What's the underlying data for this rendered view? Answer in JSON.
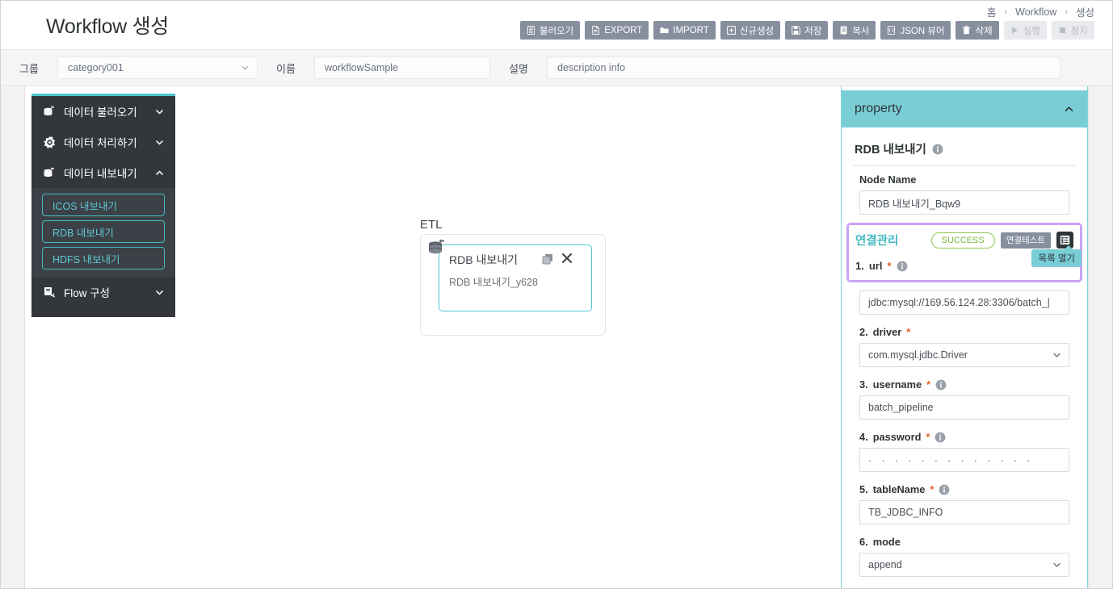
{
  "header": {
    "title": "Workflow 생성",
    "breadcrumb": [
      "홈",
      "Workflow",
      "생성"
    ],
    "breadcrumb_sep": "›",
    "toolbar": [
      {
        "label": "불러오기",
        "icon": "list-document-icon",
        "disabled": false
      },
      {
        "label": "EXPORT",
        "icon": "export-document-icon",
        "disabled": false
      },
      {
        "label": "IMPORT",
        "icon": "folder-icon",
        "disabled": false
      },
      {
        "label": "신규생성",
        "icon": "plus-square-icon",
        "disabled": false
      },
      {
        "label": "저장",
        "icon": "floppy-disk-icon",
        "disabled": false
      },
      {
        "label": "복사",
        "icon": "copy-document-icon",
        "disabled": false
      },
      {
        "label": "JSON 뷰어",
        "icon": "json-document-icon",
        "disabled": false
      },
      {
        "label": "삭제",
        "icon": "trash-icon",
        "disabled": false
      },
      {
        "label": "실행",
        "icon": "play-icon",
        "disabled": true
      },
      {
        "label": "정지",
        "icon": "stop-icon",
        "disabled": true
      }
    ]
  },
  "metabar": {
    "group": {
      "label": "그룹",
      "value": "category001",
      "icon": "chevron-down-icon"
    },
    "name": {
      "label": "이름",
      "value": "workflowSample"
    },
    "description": {
      "label": "설명",
      "value": "description info"
    }
  },
  "sidebar": {
    "groups": [
      {
        "label": "데이터 불러오기",
        "icon": "database-in-icon",
        "expanded": false,
        "chevron": "chevron-down-icon",
        "items": []
      },
      {
        "label": "데이터 처리하기",
        "icon": "gear-icon",
        "expanded": false,
        "chevron": "chevron-down-icon",
        "items": []
      },
      {
        "label": "데이터 내보내기",
        "icon": "database-out-icon",
        "expanded": true,
        "chevron": "chevron-up-icon",
        "items": [
          {
            "label": "ICOS 내보내기"
          },
          {
            "label": "RDB 내보내기"
          },
          {
            "label": "HDFS 내보내기"
          }
        ]
      },
      {
        "label": "Flow 구성",
        "icon": "flow-icon",
        "expanded": false,
        "chevron": "chevron-down-icon",
        "items": []
      }
    ]
  },
  "canvas": {
    "group_label": "ETL",
    "node": {
      "icon": "database-out-icon",
      "title": "RDB 내보내기",
      "subtitle": "RDB 내보내기_y628",
      "copy_icon": "copy-icon",
      "close_icon": "close-icon"
    }
  },
  "property": {
    "header": {
      "title": "property",
      "collapse_icon": "chevron-up-icon"
    },
    "node_type": {
      "label": "RDB 내보내기",
      "info_icon": "info-icon"
    },
    "node_name": {
      "label": "Node Name",
      "value": "RDB 내보내기_Bqw9"
    },
    "connection": {
      "title": "연결관리",
      "status_badge": "SUCCESS",
      "test_button": "연결테스트",
      "list_button_icon": "list-icon",
      "tooltip": "목록 열기",
      "highlight_color": "#c9a4f5"
    },
    "fields": [
      {
        "index": "1.",
        "name": "url",
        "required": true,
        "info": true,
        "value": "jdbc:mysql://169.56.124.28:3306/batch_|",
        "type": "text"
      },
      {
        "index": "2.",
        "name": "driver",
        "required": true,
        "info": false,
        "value": "com.mysql.jdbc.Driver",
        "type": "select"
      },
      {
        "index": "3.",
        "name": "username",
        "required": true,
        "info": true,
        "value": "batch_pipeline",
        "type": "text"
      },
      {
        "index": "4.",
        "name": "password",
        "required": true,
        "info": true,
        "value": "· · · · · · · · · · · · ·",
        "type": "password"
      },
      {
        "index": "5.",
        "name": "tableName",
        "required": true,
        "info": true,
        "value": "TB_JDBC_INFO",
        "type": "text"
      },
      {
        "index": "6.",
        "name": "mode",
        "required": false,
        "info": false,
        "value": "append",
        "type": "select"
      }
    ]
  },
  "colors": {
    "accent_teal": "#79ced6",
    "accent_teal_border": "#4ec6cf",
    "sidebar_dark": "#33373c",
    "toolbar_gray": "#878f9e",
    "highlight_purple": "#c9a4f5",
    "success_green": "#7cb542",
    "required_orange": "#e8602c"
  }
}
